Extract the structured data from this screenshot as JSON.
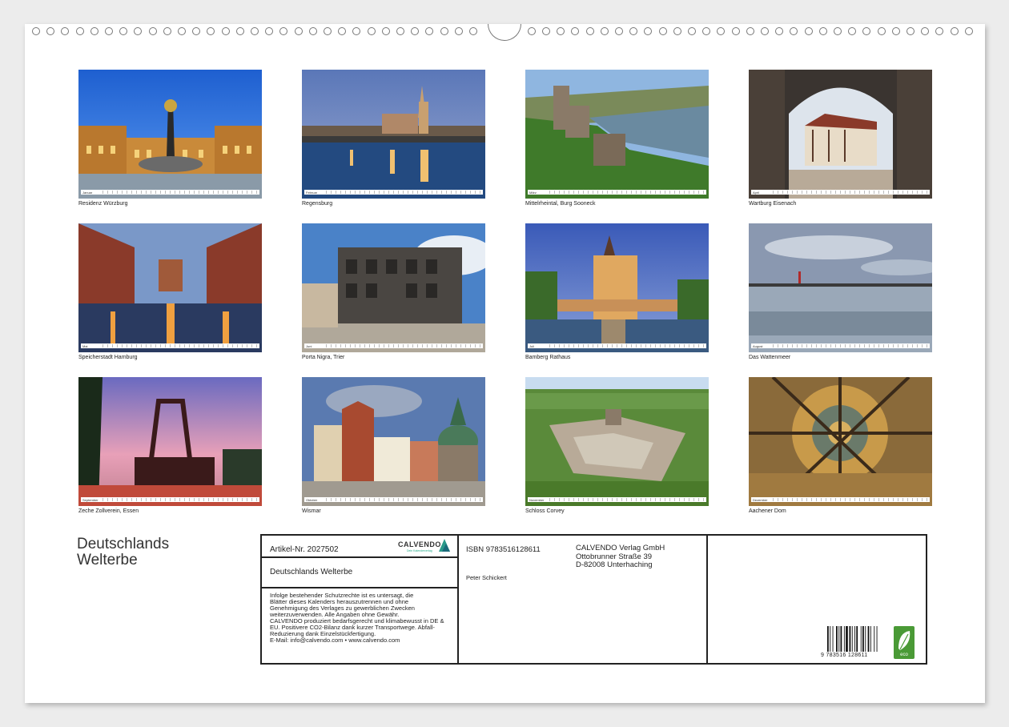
{
  "document": {
    "title_line1": "Deutschlands",
    "title_line2": "Welterbe"
  },
  "photos": [
    {
      "caption": "Residenz Würzburg",
      "month": "Januar"
    },
    {
      "caption": "Regensburg",
      "month": "Februar"
    },
    {
      "caption": "Mittelrheintal, Burg Sooneck",
      "month": "März"
    },
    {
      "caption": "Wartburg Eisenach",
      "month": "April"
    },
    {
      "caption": "Speicherstadt Hamburg",
      "month": "Mai"
    },
    {
      "caption": "Porta Nigra, Trier",
      "month": "Juni"
    },
    {
      "caption": "Bamberg Rathaus",
      "month": "Juli"
    },
    {
      "caption": "Das Wattenmeer",
      "month": "August"
    },
    {
      "caption": "Zeche Zollverein, Essen",
      "month": "September"
    },
    {
      "caption": "Wismar",
      "month": "Oktober"
    },
    {
      "caption": "Schloss Corvey",
      "month": "November"
    },
    {
      "caption": "Aachener Dom",
      "month": "Dezember"
    }
  ],
  "info": {
    "article": "Artikel-Nr. 2027502",
    "logo": "CALVENDO",
    "logo_sub": "Dein Kalenderverlag",
    "product_title": "Deutschlands Welterbe",
    "legal_lines": [
      "Infolge bestehender Schutzrechte ist es untersagt, die",
      "Blätter dieses Kalenders herauszutrennen und ohne",
      "Genehmigung des Verlages zu gewerblichen Zwecken",
      "weiterzuverwenden. Alle Angaben ohne Gewähr.",
      "CALVENDO produziert bedarfsgerecht und klimabewusst in DE &",
      "EU. Positivere CO2-Bilanz dank kurzer Transportwege. Abfall-",
      "Reduzierung dank Einzelstückfertigung.",
      "E-Mail: info@calvendo.com • www.calvendo.com"
    ],
    "isbn": "ISBN 9783516128611",
    "author": "Peter Schickert",
    "publisher_line1": "CALVENDO Verlag GmbH",
    "publisher_line2": "Ottobrunner Straße 39",
    "publisher_line3": "D-82008 Unterhaching",
    "barcode_number": "9 783516 128611",
    "eco_label": "eco"
  },
  "colors": {
    "sheet": "#ffffff",
    "background": "#ececec",
    "eco_green": "#4a9a36",
    "text": "#222222"
  }
}
